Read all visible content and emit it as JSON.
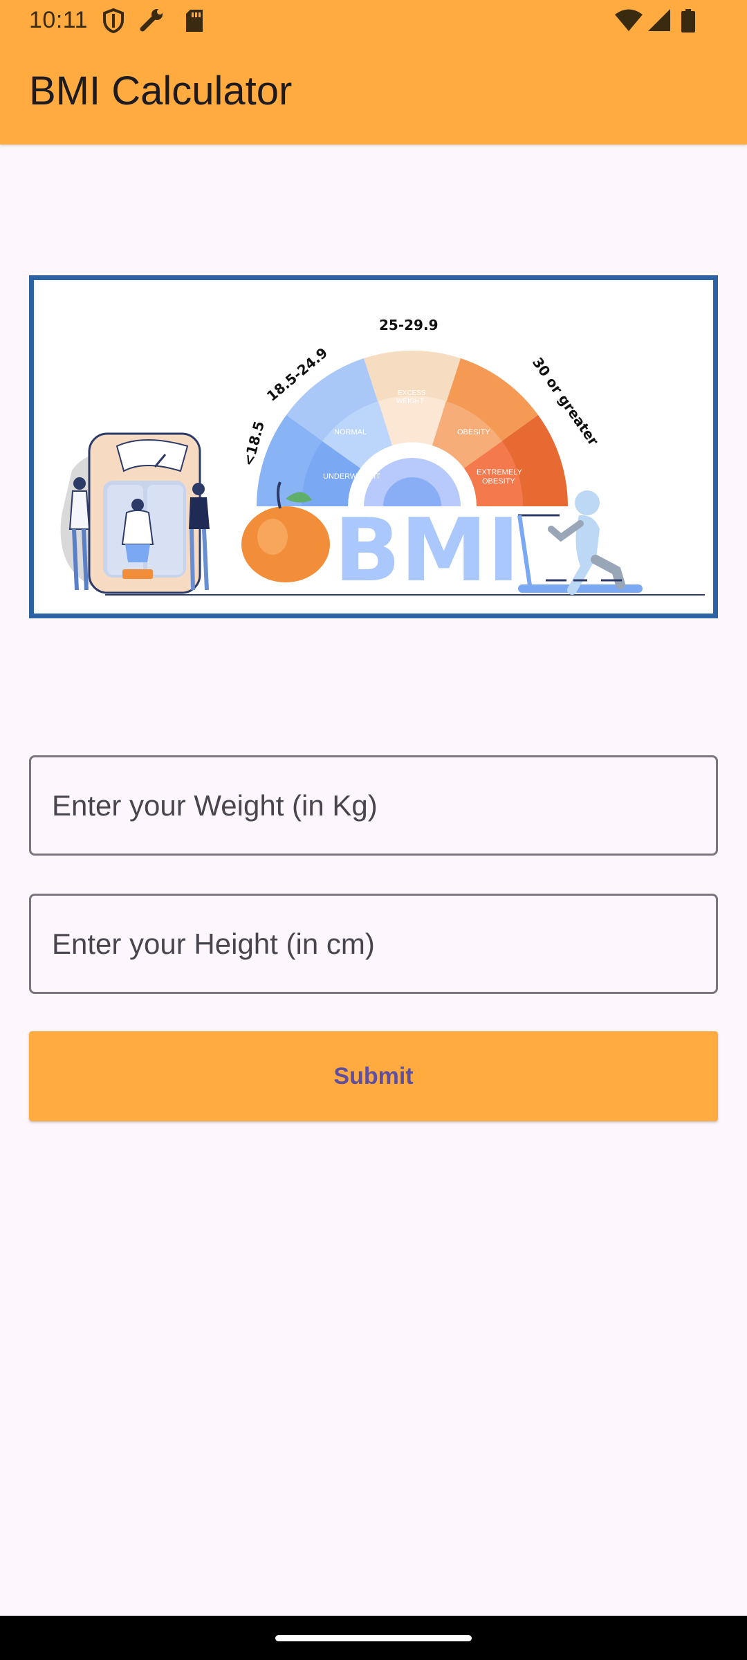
{
  "status_bar": {
    "time": "10:11",
    "left_icons": [
      "shield-icon",
      "wrench-icon",
      "sd-card-icon"
    ],
    "right_icons": [
      "wifi-icon",
      "cell-signal-icon",
      "battery-icon"
    ]
  },
  "app_bar": {
    "title": "BMI Calculator",
    "color": "#ffab40"
  },
  "banner": {
    "ranges": {
      "underweight": "<18.5",
      "normal": "18.5-24.9",
      "excess": "25-29.9",
      "obese": "30 or greater"
    },
    "segments": {
      "underweight": "UNDERWEIGHT",
      "normal": "NORMAL",
      "excess_1": "EXCESS",
      "excess_2": "WEIGHT",
      "obesity": "OBESITY",
      "extreme_1": "EXTREMELY",
      "extreme_2": "OBESITY"
    },
    "logo_text": "BMI"
  },
  "form": {
    "weight_placeholder": "Enter your Weight (in Kg)",
    "height_placeholder": "Enter your Height (in cm)",
    "submit_label": "Submit"
  }
}
